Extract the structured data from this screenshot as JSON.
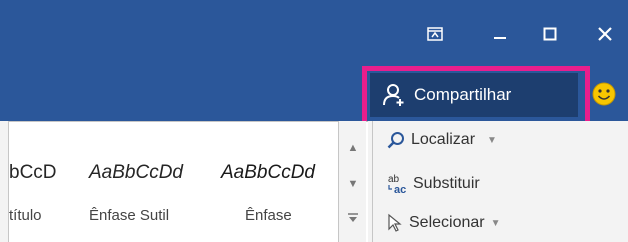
{
  "window": {
    "controls": {
      "restore_ribbon": "ribbon-display-icon",
      "minimize": "minimize-icon",
      "maximize": "maximize-icon",
      "close": "close-icon"
    }
  },
  "header": {
    "share_label": "Compartilhar",
    "share_icon": "person-add-icon",
    "feedback_icon": "smiley-icon"
  },
  "styles": {
    "items": [
      {
        "sample": "bCcD",
        "label": "título"
      },
      {
        "sample": "AaBbCcDd",
        "label": "Ênfase Sutil"
      },
      {
        "sample": "AaBbCcDd",
        "label": "Ênfase"
      }
    ]
  },
  "editing": {
    "find_label": "Localizar",
    "replace_label": "Substituir",
    "select_label": "Selecionar"
  },
  "colors": {
    "title_bar": "#2b579a",
    "share_button": "#1d3e6f",
    "highlight": "#e91e8c",
    "ribbon": "#f3f3f3"
  }
}
